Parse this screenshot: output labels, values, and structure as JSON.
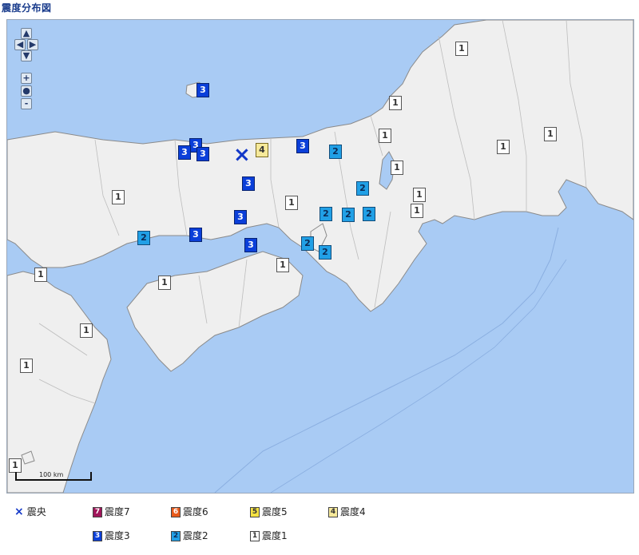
{
  "title": "震度分布図",
  "map": {
    "scale_label": "100 km",
    "epicenter_symbol": "×",
    "markers": [
      {
        "level": "1"
      },
      {
        "level": "1"
      },
      {
        "level": "1"
      },
      {
        "level": "1"
      },
      {
        "level": "1"
      },
      {
        "level": "1"
      },
      {
        "level": "1"
      },
      {
        "level": "1"
      },
      {
        "level": "1"
      },
      {
        "level": "1"
      },
      {
        "level": "1"
      },
      {
        "level": "1"
      },
      {
        "level": "1"
      },
      {
        "level": "1"
      },
      {
        "level": "1"
      },
      {
        "level": "1"
      },
      {
        "level": "2"
      },
      {
        "level": "2"
      },
      {
        "level": "2"
      },
      {
        "level": "2"
      },
      {
        "level": "2"
      },
      {
        "level": "2"
      },
      {
        "level": "2"
      },
      {
        "level": "2"
      },
      {
        "level": "3"
      },
      {
        "level": "3"
      },
      {
        "level": "3"
      },
      {
        "level": "3"
      },
      {
        "level": "3"
      },
      {
        "level": "3"
      },
      {
        "level": "3"
      },
      {
        "level": "3"
      },
      {
        "level": "3"
      },
      {
        "level": "4"
      }
    ]
  },
  "controls": {
    "up": "▲",
    "left": "◀",
    "right": "▶",
    "down": "▼",
    "zoom_in": "+",
    "center": "●",
    "zoom_out": "-"
  },
  "legend": {
    "epicenter": {
      "symbol": "×",
      "label": "震央"
    },
    "items": [
      {
        "badge": "7",
        "label": "震度7",
        "color": "#a0155a"
      },
      {
        "badge": "6",
        "label": "震度6",
        "color": "#e85a1b"
      },
      {
        "badge": "5",
        "label": "震度5",
        "color": "#f4e243"
      },
      {
        "badge": "4",
        "label": "震度4",
        "color": "#f6e99a"
      },
      {
        "badge": "3",
        "label": "震度3",
        "color": "#0b3fd9"
      },
      {
        "badge": "2",
        "label": "震度2",
        "color": "#21a0e6"
      },
      {
        "badge": "1",
        "label": "震度1",
        "color": "#ffffff"
      }
    ]
  }
}
